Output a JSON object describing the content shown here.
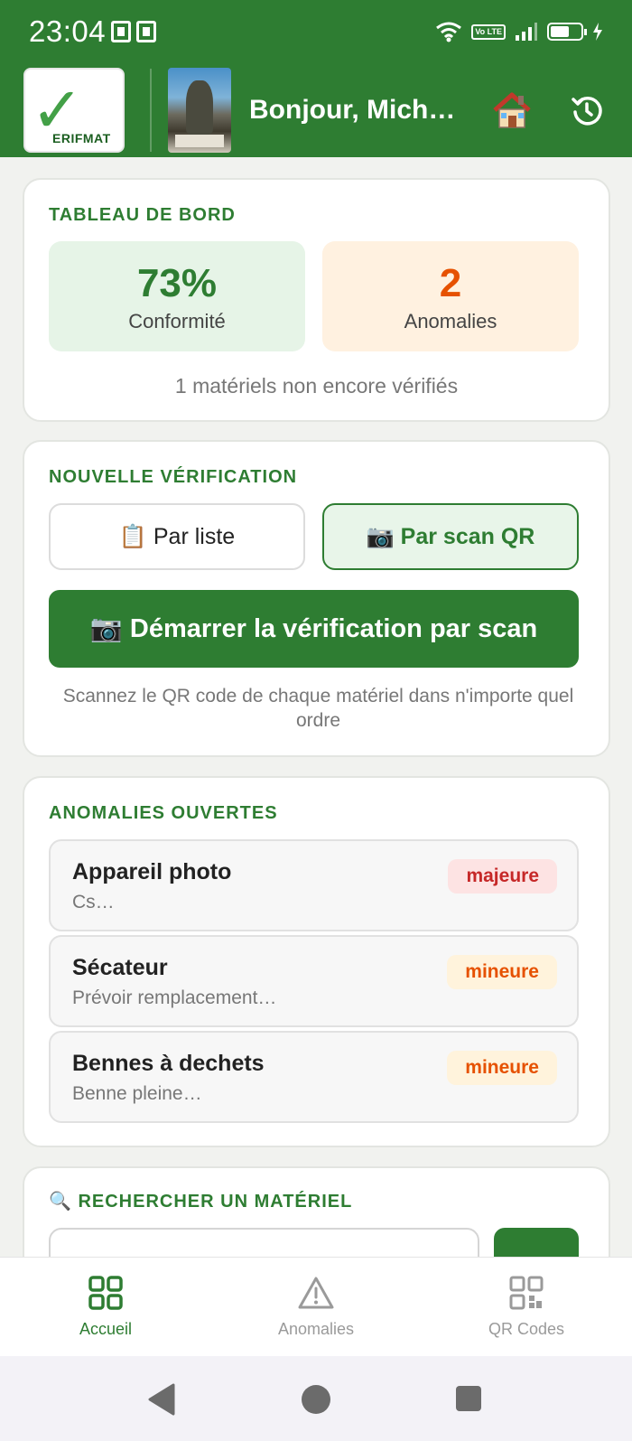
{
  "status_bar": {
    "time": "23:04",
    "volte_label": "Vo LTE"
  },
  "header": {
    "logo_text": "ERIFMAT",
    "greeting": "Bonjour, Mich…"
  },
  "dashboard": {
    "title": "TABLEAU DE BORD",
    "conformity_value": "73%",
    "conformity_label": "Conformité",
    "anomalies_value": "2",
    "anomalies_label": "Anomalies",
    "note": "1 matériels non encore vérifiés"
  },
  "new_verification": {
    "title": "NOUVELLE VÉRIFICATION",
    "mode_list": "📋 Par liste",
    "mode_scan": "📷 Par scan QR",
    "selected_mode": "scan",
    "cta": "📷 Démarrer la vérification par scan",
    "hint": "Scannez le QR code de chaque matériel dans n'importe quel ordre"
  },
  "open_anomalies": {
    "title": "ANOMALIES OUVERTES",
    "items": [
      {
        "name": "Appareil photo",
        "desc": "Cs…",
        "severity": "majeure"
      },
      {
        "name": "Sécateur",
        "desc": "Prévoir remplacement…",
        "severity": "mineure"
      },
      {
        "name": "Bennes à dechets",
        "desc": "Benne pleine…",
        "severity": "mineure"
      }
    ]
  },
  "search": {
    "title": "🔍 RECHERCHER UN MATÉRIEL"
  },
  "bottom_nav": {
    "items": [
      {
        "label": "Accueil",
        "icon": "grid-icon",
        "active": true
      },
      {
        "label": "Anomalies",
        "icon": "warning-icon",
        "active": false
      },
      {
        "label": "QR Codes",
        "icon": "qr-code-icon",
        "active": false
      }
    ]
  },
  "colors": {
    "primary": "#2e7d32",
    "major": "#c62828",
    "minor": "#e65100"
  }
}
